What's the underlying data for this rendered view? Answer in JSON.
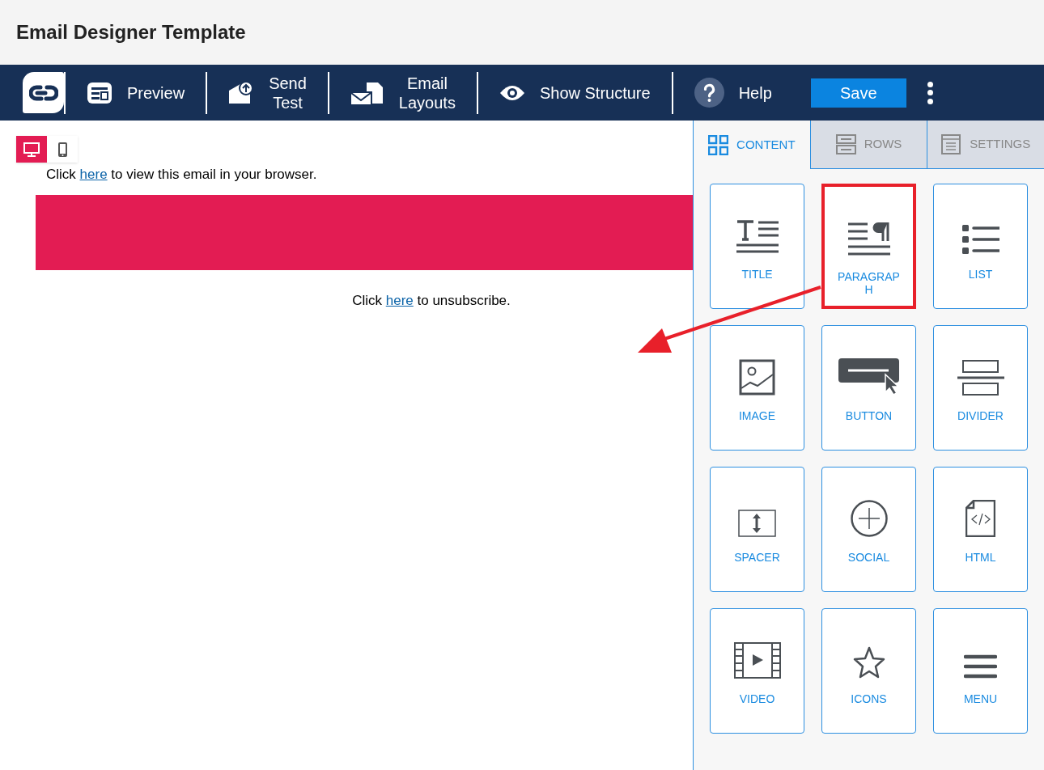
{
  "page_title": "Email Designer Template",
  "toolbar": [
    {
      "kind": "preview",
      "label": "Preview"
    },
    {
      "kind": "send",
      "label": "Send\nTest"
    },
    {
      "kind": "layouts",
      "label": "Email\nLayouts"
    },
    {
      "kind": "structure",
      "label": "Show Structure"
    },
    {
      "kind": "help",
      "label": "Help"
    }
  ],
  "save_button": "Save",
  "device_toggle": [
    {
      "kind": "desktop",
      "selected": true
    },
    {
      "kind": "mobile",
      "selected": false
    }
  ],
  "email": {
    "header_parts": [
      "Click ",
      "here",
      " to view this email in your browser."
    ],
    "footer_parts": [
      "Click ",
      "here",
      " to unsubscribe."
    ]
  },
  "tabs": [
    {
      "kind": "content",
      "label": "CONTENT",
      "selected": true
    },
    {
      "kind": "rows",
      "label": "ROWS",
      "selected": false
    },
    {
      "kind": "settings",
      "label": "SETTINGS",
      "selected": false
    }
  ],
  "blocks": [
    {
      "kind": "title",
      "label": "TITLE",
      "highlighted": false
    },
    {
      "kind": "paragraph",
      "label": "PARAGRAP\nH",
      "highlighted": true
    },
    {
      "kind": "list",
      "label": "LIST",
      "highlighted": false
    },
    {
      "kind": "image",
      "label": "IMAGE",
      "highlighted": false
    },
    {
      "kind": "button",
      "label": "BUTTON",
      "highlighted": false
    },
    {
      "kind": "divider",
      "label": "DIVIDER",
      "highlighted": false
    },
    {
      "kind": "spacer",
      "label": "SPACER",
      "highlighted": false
    },
    {
      "kind": "social",
      "label": "SOCIAL",
      "highlighted": false
    },
    {
      "kind": "html",
      "label": "HTML",
      "highlighted": false
    },
    {
      "kind": "video",
      "label": "VIDEO",
      "highlighted": false
    },
    {
      "kind": "icons",
      "label": "ICONS",
      "highlighted": false
    },
    {
      "kind": "menu",
      "label": "MENU",
      "highlighted": false
    }
  ]
}
